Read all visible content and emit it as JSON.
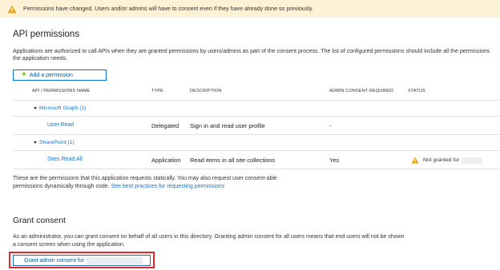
{
  "banner": {
    "text": "Permissions have changed. Users and/or admins will have to consent even if they have already done so previously."
  },
  "api_permissions": {
    "title": "API permissions",
    "description": "Applications are authorized to call APIs when they are granted permissions by users/admins as part of the consent process. The list of configured permissions should include all the permissions the application needs.",
    "add_button": "Add a permission",
    "columns": [
      "API / PERMISSIONS NAME",
      "TYPE",
      "DESCRIPTION",
      "ADMIN CONSENT REQUIRED",
      "STATUS"
    ],
    "groups": [
      {
        "name": "Microsoft Graph (1)",
        "rows": [
          {
            "name": "User.Read",
            "type": "Delegated",
            "description": "Sign in and read user profile",
            "admin_consent": "-",
            "status": ""
          }
        ]
      },
      {
        "name": "SharePoint (1)",
        "rows": [
          {
            "name": "Sites.Read.All",
            "type": "Application",
            "description": "Read items in all site collections",
            "admin_consent": "Yes",
            "status": "Not granted for"
          }
        ]
      }
    ],
    "static_note": "These are the permissions that this application requests statically. You may also request user consent-able permissions dynamically through code.",
    "best_practices_link": "See best practices for requesting permissions"
  },
  "grant_consent": {
    "title": "Grant consent",
    "description": "As an administrator, you can grant consent on behalf of all users in this directory. Granting admin consent for all users means that end users will not be shown a consent screen when using the application.",
    "button": "Grant admin consent for"
  },
  "colors": {
    "warning": "#e8a317",
    "link": "#1a73c8",
    "highlight": "#e0282a",
    "banner_bg": "#fdf1d6"
  }
}
